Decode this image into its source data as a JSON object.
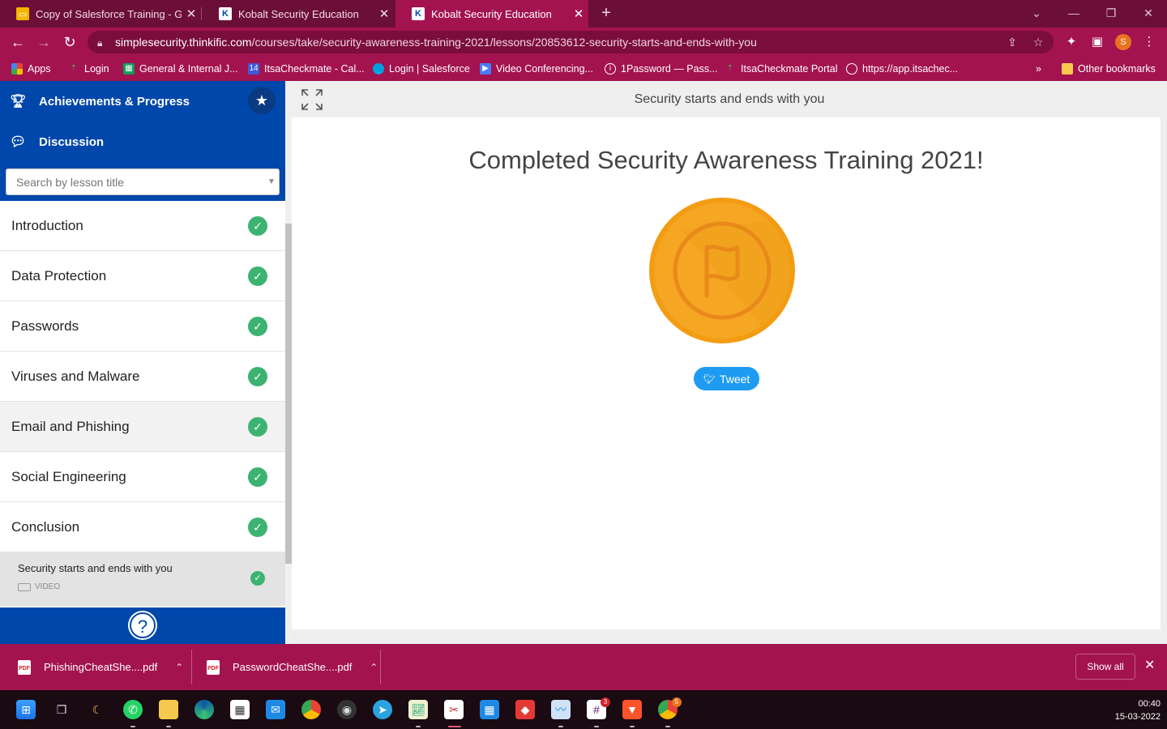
{
  "browser": {
    "tabs": [
      {
        "title": "Copy of Salesforce Training - Goo",
        "favicon": "google-slides-icon",
        "active": false
      },
      {
        "title": "Kobalt Security Education",
        "favicon": "kobalt-k-icon",
        "active": false
      },
      {
        "title": "Kobalt Security Education",
        "favicon": "kobalt-k-icon",
        "active": true
      }
    ],
    "url_host": "simplesecurity.thinkific.com",
    "url_path": "/courses/take/security-awareness-training-2021/lessons/20853612-security-starts-and-ends-with-you",
    "profile_initial": "S",
    "bookmarks": [
      {
        "label": "Apps",
        "icon": "apps-grid-icon"
      },
      {
        "label": "Login",
        "icon": "login-icon"
      },
      {
        "label": "General & Internal J...",
        "icon": "sheet-icon"
      },
      {
        "label": "ItsaCheckmate - Cal...",
        "icon": "calendar-icon"
      },
      {
        "label": "Login | Salesforce",
        "icon": "salesforce-cloud-icon"
      },
      {
        "label": "Video Conferencing...",
        "icon": "video-icon"
      },
      {
        "label": "1Password — Pass...",
        "icon": "onepassword-icon"
      },
      {
        "label": "ItsaCheckmate Portal",
        "icon": "login-icon"
      },
      {
        "label": "https://app.itsachec...",
        "icon": "globe-icon"
      }
    ],
    "bookmarks_overflow": "»",
    "other_bookmarks": "Other bookmarks"
  },
  "sidebar": {
    "achievements_label": "Achievements & Progress",
    "discussion_label": "Discussion",
    "search_placeholder": "Search by lesson title",
    "chapters": [
      {
        "title": "Introduction",
        "completed": true
      },
      {
        "title": "Data Protection",
        "completed": true
      },
      {
        "title": "Passwords",
        "completed": true
      },
      {
        "title": "Viruses and Malware",
        "completed": true
      },
      {
        "title": "Email and Phishing",
        "completed": true
      },
      {
        "title": "Social Engineering",
        "completed": true
      },
      {
        "title": "Conclusion",
        "completed": true
      }
    ],
    "current_lesson": {
      "title": "Security starts and ends with you",
      "type": "VIDEO",
      "completed": true
    },
    "help_label": "?"
  },
  "main": {
    "lesson_title": "Security starts and ends with you",
    "heading": "Completed Security Awareness Training 2021!",
    "badge_icon": "flag-badge-icon",
    "tweet_label": "Tweet"
  },
  "downloads": {
    "items": [
      {
        "filename": "PhishingCheatShe....pdf"
      },
      {
        "filename": "PasswordCheatShe....pdf"
      }
    ],
    "show_all": "Show all"
  },
  "taskbar": {
    "time": "00:40",
    "date": "15-03-2022",
    "slack_badge": "3",
    "chrome_badge": "5"
  },
  "colors": {
    "browser_frame": "#a3134f",
    "tab_strip": "#6b0f38",
    "sidebar_blue": "#0047ab",
    "check_green": "#3cb371",
    "tweet_blue": "#1d9bf0",
    "badge_gold": "#f5a623"
  }
}
